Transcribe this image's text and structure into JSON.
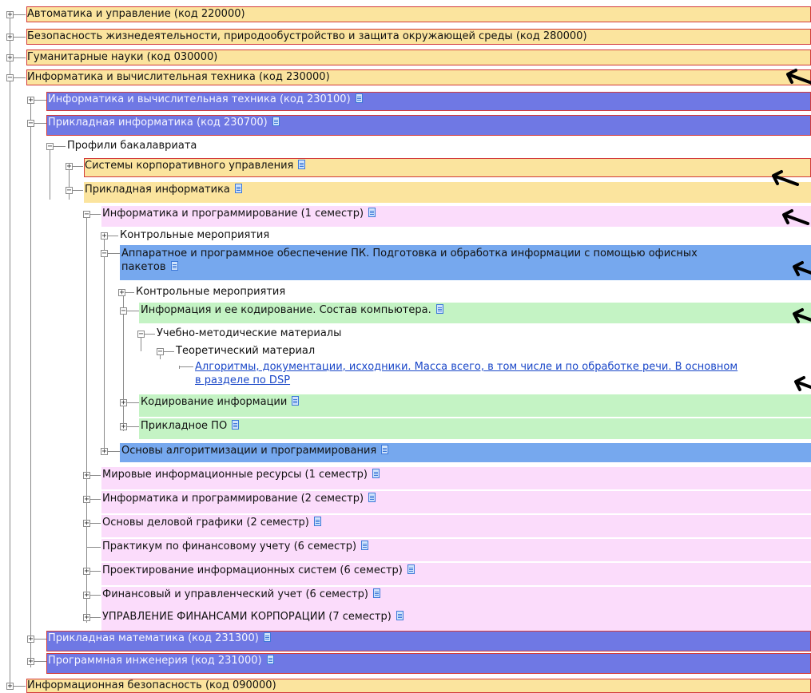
{
  "tree": {
    "nodes": [
      {
        "label": "Автоматика и управление (код 220000)",
        "state": "collapsed"
      },
      {
        "label": "Безопасность жизнедеятельности, природообустройство и защита окружающей среды (код 280000)",
        "state": "collapsed"
      },
      {
        "label": "Гуманитарные науки (код 030000)",
        "state": "collapsed"
      },
      {
        "label": "Информатика и вычислительная техника (код 230000)",
        "state": "expanded"
      },
      {
        "label": "Информатика и вычислительная техника (код 230100)",
        "state": "collapsed",
        "doc": true
      },
      {
        "label": "Прикладная информатика (код 230700)",
        "state": "expanded",
        "doc": true
      },
      {
        "label": "Профили бакалавриата",
        "state": "expanded"
      },
      {
        "label": "Системы корпоративного управления",
        "state": "collapsed",
        "doc": true
      },
      {
        "label": "Прикладная информатика",
        "state": "expanded",
        "doc": true
      },
      {
        "label": "Информатика и программирование (1 семестр)",
        "state": "expanded",
        "doc": true
      },
      {
        "label": "Контрольные мероприятия",
        "state": "collapsed"
      },
      {
        "label": "Аппаратное и программное обеспечение ПК. Подготовка и обработка информации с помощью офисных",
        "label2": "пакетов",
        "state": "expanded",
        "doc": true
      },
      {
        "label": "Контрольные мероприятия",
        "state": "collapsed"
      },
      {
        "label": "Информация и ее кодирование. Состав компьютера.",
        "state": "expanded",
        "doc": true
      },
      {
        "label": "Учебно-методические материалы",
        "state": "expanded"
      },
      {
        "label": "Теоретический материал",
        "state": "expanded"
      },
      {
        "label": "Алгоритмы, документации, исходники. Масса всего, в том числе и по обработке речи. В основном",
        "label2": "в разделе по DSP",
        "state": "leaf"
      },
      {
        "label": "Кодирование информации",
        "state": "collapsed",
        "doc": true
      },
      {
        "label": "Прикладное ПО",
        "state": "collapsed",
        "doc": true
      },
      {
        "label": "Основы алгоритмизации и программирования",
        "state": "collapsed",
        "doc": true
      },
      {
        "label": "Мировые информационные ресурсы (1 семестр)",
        "state": "collapsed",
        "doc": true
      },
      {
        "label": "Информатика и программирование (2 семестр)",
        "state": "collapsed",
        "doc": true
      },
      {
        "label": "Основы деловой графики (2 семестр)",
        "state": "collapsed",
        "doc": true
      },
      {
        "label": "Практикум по финансовому учету (6 семестр)",
        "state": "leaf",
        "doc": true
      },
      {
        "label": "Проектирование информационных систем (6 семестр)",
        "state": "collapsed",
        "doc": true
      },
      {
        "label": "Финансовый и управленческий учет (6 семестр)",
        "state": "collapsed",
        "doc": true
      },
      {
        "label": "УПРАВЛЕНИЕ ФИНАНСАМИ КОРПОРАЦИИ (7 семестр)",
        "state": "collapsed",
        "doc": true
      },
      {
        "label": "Прикладная математика (код 231300)",
        "state": "collapsed",
        "doc": true
      },
      {
        "label": "Программная инженерия (код 231000)",
        "state": "collapsed",
        "doc": true
      },
      {
        "label": "Информационная безопасность (код 090000)",
        "state": "collapsed"
      }
    ],
    "expander_glyphs": {
      "collapsed": "+",
      "expanded": "−"
    }
  },
  "icons": {
    "document": "document-icon",
    "annotation_arrow": "arrow-icon"
  },
  "colors": {
    "category": "#fbe49e",
    "specialty": "#6f78e4",
    "border": "#d23a3a",
    "subject": "#fbdcfb",
    "module": "#76a8ee",
    "topic": "#c4f3c4",
    "link": "#1a47c8",
    "annotation": "#000000"
  }
}
